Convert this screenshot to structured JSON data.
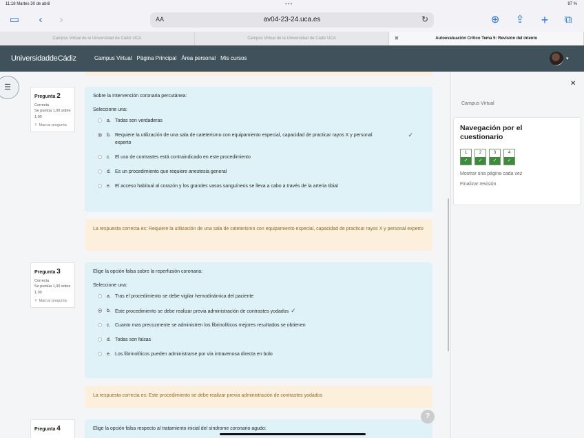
{
  "status": {
    "time": "11:18  Martes 30 de abril",
    "battery": "97 %"
  },
  "browser": {
    "aa_label": "AA",
    "url": "av04-23-24.uca.es",
    "tabs": [
      "Campus Virtual de la Universidad de Cádiz UCA",
      "Campus Virtual de la Universidad de Cádiz UCA",
      "Autoevaluación Crítico Tema 5: Revisión del intento"
    ]
  },
  "site": {
    "brand": "UniversidaddeCádiz",
    "nav": [
      "Campus Virtual",
      "Página Principal",
      "Área personal",
      "Mis cursos"
    ]
  },
  "questions": [
    {
      "number_label": "Pregunta",
      "number": "2",
      "state": "Correcta",
      "grade": "Se puntúa 1,00 sobre 1,00",
      "flag": "Marcar pregunta",
      "prompt": "Sobre la Intervención coronaria percutánea:",
      "select_label": "Seleccione una:",
      "answers": [
        {
          "letter": "a.",
          "text": "Todas son verdaderas"
        },
        {
          "letter": "b.",
          "text": "Requiere la utilización de una sala de cateterismo con equipamiento especial, capacidad de practicar rayos X y personal experto"
        },
        {
          "letter": "c.",
          "text": "El uso de contrastes está contraindicado en este procedimiento"
        },
        {
          "letter": "d.",
          "text": "Es un procedimiento que requiere anestesia general"
        },
        {
          "letter": "e.",
          "text": "El acceso habitual al corazón y los grandes vasos sanguíneos se lleva a cabo a través de la arteria tibial"
        }
      ],
      "feedback": "La respuesta correcta es: Requiere la utilización de una sala de cateterismo con equipamiento especial, capacidad de practicar rayos X y personal experto"
    },
    {
      "number_label": "Pregunta",
      "number": "3",
      "state": "Correcta",
      "grade": "Se puntúa 1,00 sobre 1,00",
      "flag": "Marcar pregunta",
      "prompt": "Elige la opción falsa sobre la reperfusión coronaria:",
      "select_label": "Seleccione una:",
      "answers": [
        {
          "letter": "a.",
          "text": "Tras el procedimiento se debe vigilar hemodinámica del paciente"
        },
        {
          "letter": "b.",
          "text": "Este procedimiento se debe realizar previa administración de contrastes yodados"
        },
        {
          "letter": "c.",
          "text": "Cuanto mas precozmente se administren los fibrinolíticos mejores resultados se obtienen"
        },
        {
          "letter": "d.",
          "text": "Todas son falsas"
        },
        {
          "letter": "e.",
          "text": "Los fibrinolíticos pueden administrarse por vía intravenosa directa en bolo"
        }
      ],
      "feedback": "La respuesta correcta es: Este procedimiento se debe realizar previa administración de contrastes yodados"
    },
    {
      "number_label": "Pregunta",
      "number": "4",
      "prompt": "Elige la opción falsa respecto al tratamiento inicial del síndrome coronario agudo:"
    }
  ],
  "drawer": {
    "crumb": "Campus Virtual",
    "title": "Navegación por el cuestionario",
    "buttons": [
      "1",
      "2",
      "3",
      "4"
    ],
    "show_one_page": "Mostrar una página cada vez",
    "finish_review": "Finalizar revisión"
  },
  "help_label": "?"
}
